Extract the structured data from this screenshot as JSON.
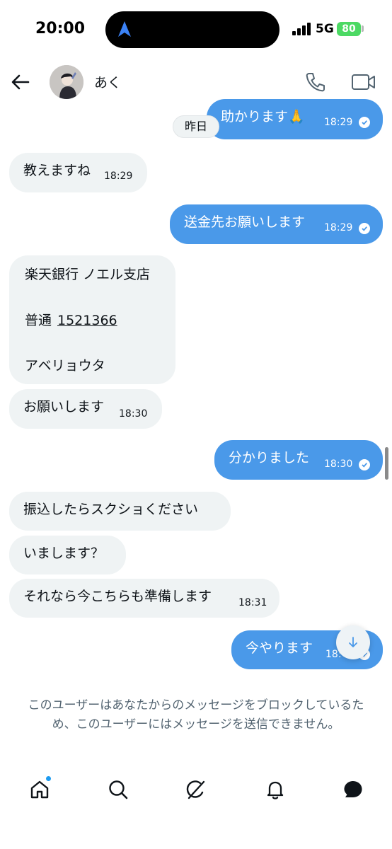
{
  "status_bar": {
    "time": "20:00",
    "network": "5G",
    "battery": "80"
  },
  "header": {
    "name": "あく"
  },
  "chat": {
    "date_separator": "昨日",
    "messages": [
      {
        "dir": "out",
        "text": "助かります🙏",
        "time": "18:29",
        "read": true
      },
      {
        "dir": "in",
        "text": "教えますね",
        "time": "18:29"
      },
      {
        "dir": "out",
        "text": "送金先お願いします",
        "time": "18:29",
        "read": true
      },
      {
        "dir": "in",
        "lines": [
          "楽天銀行 ノエル支店",
          "普通",
          "1521366",
          "アベリョウタ"
        ]
      },
      {
        "dir": "in",
        "text": "お願いします",
        "time": "18:30"
      },
      {
        "dir": "out",
        "text": "分かりました",
        "time": "18:30",
        "read": true
      },
      {
        "dir": "in",
        "text": "振込したらスクショください"
      },
      {
        "dir": "in",
        "text": "いまします？"
      },
      {
        "dir": "in",
        "text": "それなら今こちらも準備します",
        "time": "18:31"
      },
      {
        "dir": "out",
        "text": "今やります",
        "time": "18:",
        "read": true
      }
    ]
  },
  "blocked_notice": "このユーザーはあなたからのメッセージをブロックしているため、このユーザーにはメッセージを送信できません。",
  "bottom_nav": {
    "items": [
      "home-icon",
      "search-icon",
      "grok-icon",
      "notifications-icon",
      "messages-icon"
    ],
    "active": "messages-icon",
    "home_unread_dot": true
  },
  "colors": {
    "outgoing_bubble": "#4a99e9",
    "incoming_bubble": "#eff3f4",
    "notice_text": "#536471",
    "accent": "#1d9bf0"
  }
}
